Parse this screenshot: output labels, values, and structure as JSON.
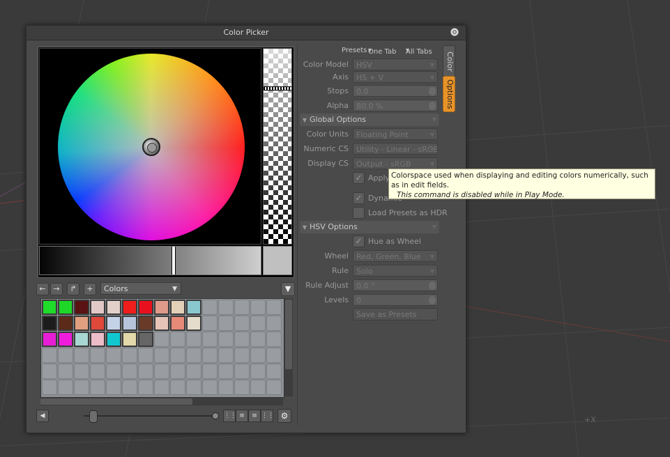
{
  "window": {
    "title": "Color Picker"
  },
  "wheel": {
    "hue_deg": 0,
    "saturation": 0.0,
    "value": 0.75,
    "alpha": 0.8
  },
  "toolbar": {
    "collection_value": "Colors",
    "icons": [
      "arrow-left-icon",
      "arrow-right-icon",
      "up-folder-icon",
      "add-icon",
      "filter-icon"
    ]
  },
  "swatches": {
    "columns": 15,
    "rows": 6,
    "colors": [
      [
        "#1fdc2a",
        "#1ed627",
        "#5a1212",
        "#e2c9c7",
        "#e3cfca",
        "#f01d1d",
        "#e9101e",
        "#e09a8a",
        "#e2d0b8",
        "#8ac8d0"
      ],
      [
        "#1c1c1c",
        "#5c2a18",
        "#e0a080",
        "#e0483a",
        "#c4d2e8",
        "#b6c4dc",
        "#6a3a28",
        "#e6c4b8",
        "#e88a78",
        "#e6dccc"
      ],
      [
        "#e81ed6",
        "#f01cdc",
        "#a8d6d2",
        "#ecbcc8",
        "#11c8d0",
        "#e2d8a8",
        "#666666"
      ]
    ]
  },
  "bottombar": {
    "icons": [
      "sidebar-toggle-icon",
      "grid-view-icon",
      "list-view-icon",
      "detail-view-icon",
      "large-grid-icon",
      "gear-icon"
    ],
    "icon_size": 0.08
  },
  "presets": {
    "label": "Presets",
    "one_tab": "One Tab",
    "all_tabs": "All Tabs"
  },
  "tabs": {
    "color": "Color",
    "options": "Options"
  },
  "options": {
    "color_model": {
      "label": "Color Model",
      "value": "HSV"
    },
    "axis": {
      "label": "Axis",
      "value": "HS + V"
    },
    "stops": {
      "label": "Stops",
      "value": "0.0"
    },
    "alpha": {
      "label": "Alpha",
      "value": "80.0 %"
    },
    "global_header": "Global Options",
    "color_units": {
      "label": "Color Units",
      "value": "Floating Point"
    },
    "numeric_cs": {
      "label": "Numeric CS",
      "value": "Utility - Linear - sRGB"
    },
    "display_cs": {
      "label": "Display CS",
      "value": "Output - sRGB"
    },
    "apply_label": "Apply",
    "dynamic_label": "Dynamic",
    "load_presets_hdr": "Load Presets as HDR",
    "hsv_header": "HSV Options",
    "hue_as_wheel": "Hue as Wheel",
    "wheel": {
      "label": "Wheel",
      "value": "Red, Green, Blue"
    },
    "rule": {
      "label": "Rule",
      "value": "Solo"
    },
    "rule_adjust": {
      "label": "Rule Adjust",
      "value": "0.0 °"
    },
    "levels": {
      "label": "Levels",
      "value": "0"
    },
    "save_as_presets": "Save as Presets"
  },
  "tooltip": {
    "line1": "Colorspace used when displaying and editing colors numerically, such as in edit fields.",
    "line2": "This command is disabled while in Play Mode."
  },
  "viewport": {
    "cursor_text": "+X"
  }
}
